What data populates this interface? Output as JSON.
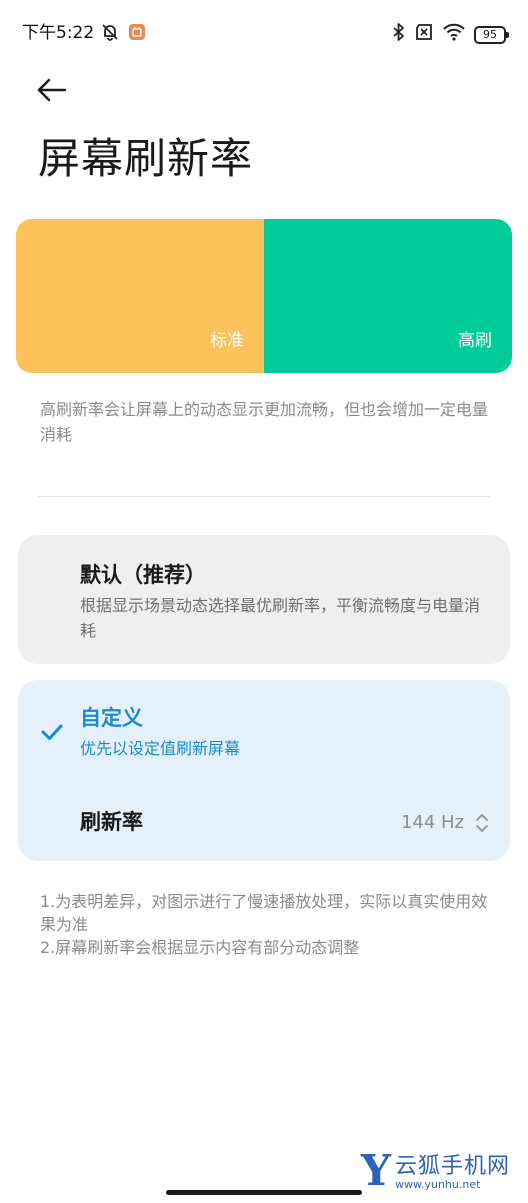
{
  "status_bar": {
    "time": "下午5:22",
    "battery_level": "95",
    "icons": [
      "mute-icon",
      "app-notification-icon",
      "bluetooth-icon",
      "sim-icon",
      "wifi-icon",
      "battery-icon"
    ]
  },
  "header": {
    "back_icon": "arrow-left-icon",
    "title": "屏幕刷新率"
  },
  "preview": {
    "standard_label": "标准",
    "high_label": "高刷",
    "colors": {
      "standard": "#fdc25b",
      "high": "#00cc9a"
    }
  },
  "description": "高刷新率会让屏幕上的动态显示更加流畅，但也会增加一定电量消耗",
  "options": {
    "default": {
      "title": "默认（推荐）",
      "subtitle": "根据显示场景动态选择最优刷新率，平衡流畅度与电量消耗",
      "selected": false
    },
    "custom": {
      "title": "自定义",
      "subtitle": "优先以设定值刷新屏幕",
      "selected": true,
      "check_icon": "checkmark-icon",
      "refresh_rate": {
        "label": "刷新率",
        "value": "144 Hz",
        "icon": "up-down-chevron-icon"
      }
    }
  },
  "notes": [
    "1.为表明差异，对图示进行了慢速播放处理，实际以真实使用效果为准",
    "2.屏幕刷新率会根据显示内容有部分动态调整"
  ],
  "watermark": {
    "letter": "Y",
    "name": "云狐手机网",
    "url": "www.yunhu.net"
  },
  "theme": {
    "accent": "#1a8ad4",
    "custom_card_bg": "#e4f0fa",
    "default_card_bg": "#efefef"
  }
}
